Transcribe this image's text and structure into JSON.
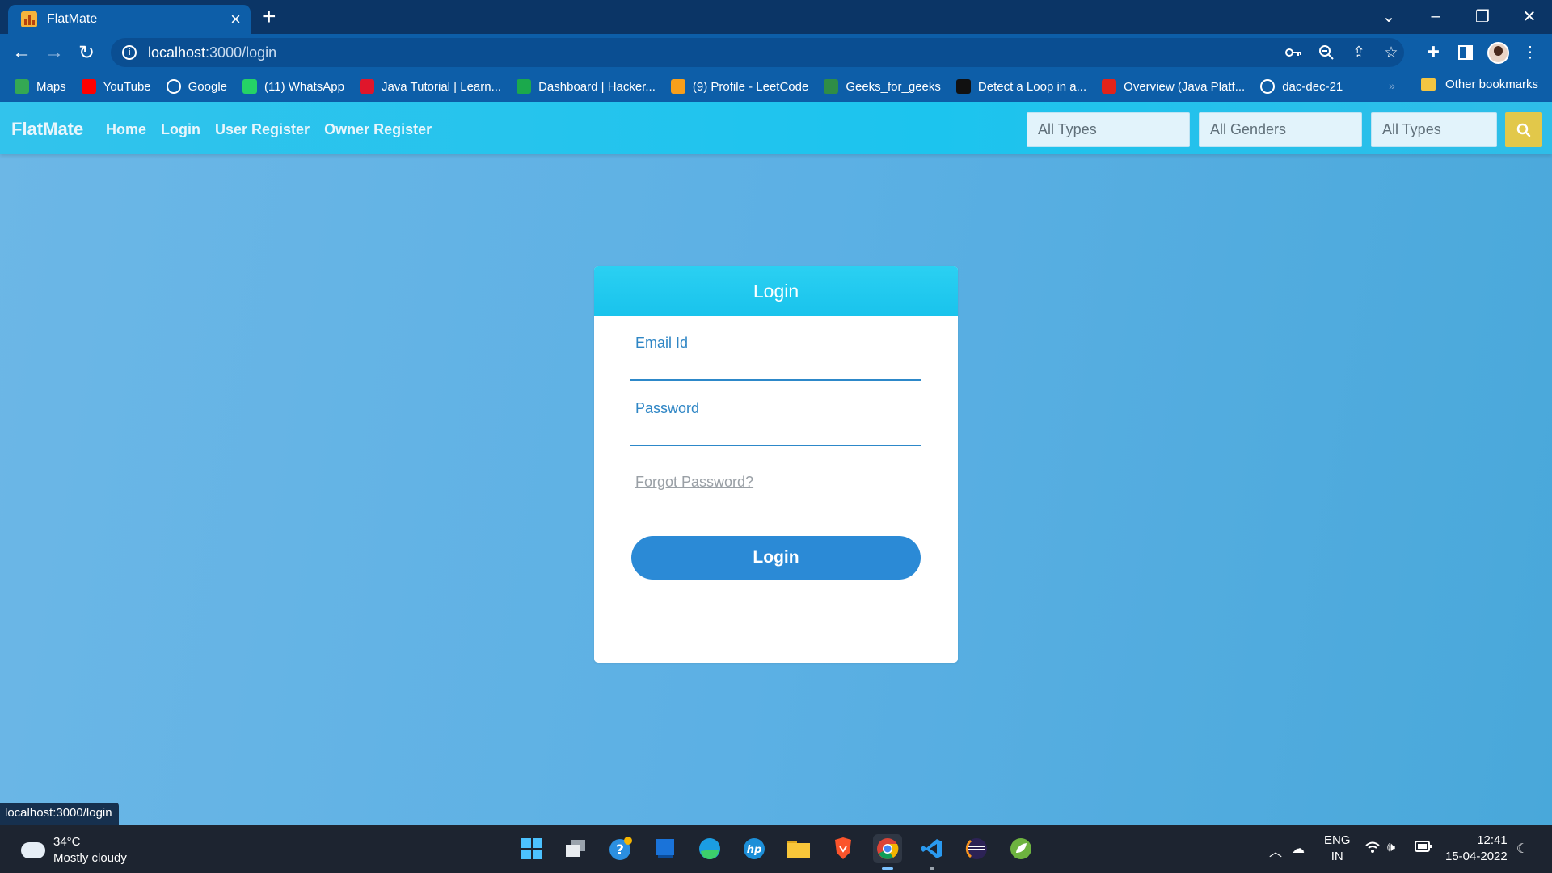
{
  "browser": {
    "tab_title": "FlatMate",
    "new_tab_symbol": "+",
    "url_host": "localhost",
    "url_path": ":3000/login",
    "bookmarks": [
      {
        "label": "Maps",
        "icon": "maps-icon",
        "color": "#34a853"
      },
      {
        "label": "YouTube",
        "icon": "youtube-icon",
        "color": "#ff0000"
      },
      {
        "label": "Google",
        "icon": "google-icon",
        "color": "#ffffff"
      },
      {
        "label": "(11) WhatsApp",
        "icon": "whatsapp-icon",
        "color": "#25d366"
      },
      {
        "label": "Java Tutorial | Learn...",
        "icon": "javatutorial-icon",
        "color": "#e0162b"
      },
      {
        "label": "Dashboard | Hacker...",
        "icon": "hackerrank-icon",
        "color": "#1ba94c"
      },
      {
        "label": "(9) Profile - LeetCode",
        "icon": "leetcode-icon",
        "color": "#f89f1b"
      },
      {
        "label": "Geeks_for_geeks",
        "icon": "geeksforgeeks-icon",
        "color": "#2f8d46"
      },
      {
        "label": "Detect a Loop in a...",
        "icon": "play-icon",
        "color": "#111111"
      },
      {
        "label": "Overview (Java Platf...",
        "icon": "oracle-icon",
        "color": "#e2231a"
      },
      {
        "label": "dac-dec-21",
        "icon": "github-icon",
        "color": "#ffffff"
      }
    ],
    "other_bookmarks": "Other bookmarks",
    "more_symbol": "»"
  },
  "app": {
    "brand": "FlatMate",
    "nav": {
      "home": "Home",
      "login": "Login",
      "user_register": "User Register",
      "owner_register": "Owner Register"
    },
    "filters": {
      "type": "All Types",
      "gender": "All Genders",
      "type2": "All Types"
    }
  },
  "login": {
    "title": "Login",
    "email_label": "Email Id",
    "email_value": "",
    "password_label": "Password",
    "password_value": "",
    "forgot": "Forgot Password?",
    "button": "Login"
  },
  "status_url": "localhost:3000/login",
  "taskbar": {
    "temperature": "34°C",
    "weather": "Mostly cloudy",
    "lang_top": "ENG",
    "lang_bottom": "IN",
    "time": "12:41",
    "date": "15-04-2022"
  },
  "colors": {
    "nav_accent": "#1cc4ee",
    "button": "#2b8ad6",
    "search": "#e2c84a",
    "browser": "#0d5ea8"
  }
}
